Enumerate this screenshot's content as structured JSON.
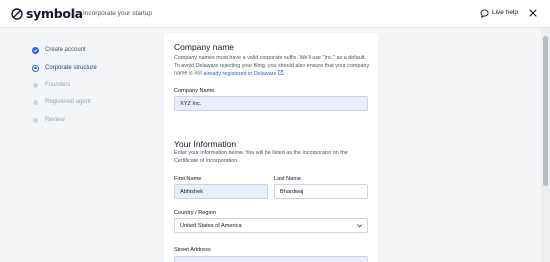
{
  "header": {
    "brand": "symbola",
    "subtitle": "Incorporate your startup",
    "live_help_label": "Live help",
    "icons": [
      "symbola-logo-icon",
      "chat-bubble-icon",
      "close-icon"
    ]
  },
  "steps": [
    {
      "label": "Create account",
      "state": "done"
    },
    {
      "label": "Corporate structure",
      "state": "current"
    },
    {
      "label": "Founders",
      "state": "todo"
    },
    {
      "label": "Registered agent",
      "state": "todo"
    },
    {
      "label": "Review",
      "state": "todo"
    }
  ],
  "company": {
    "title": "Company name",
    "desc_text": "Company names must have a valid corporate suffix. We'll use \"Inc.\" as a default. To avoid Delaware rejecting your filing, you should also ensure that your company name is not",
    "desc_link": "already registered in Delaware",
    "field_label": "Company Name",
    "field_value": "XYZ Inc."
  },
  "info": {
    "title": "Your Information",
    "desc": "Enter your information below. You will be listed as the incorporator on the Certificate of Incorporation.",
    "first_name_label": "First Name",
    "first_name_value": "Abhishek",
    "last_name_label": "Last Name",
    "last_name_value": "Bhardwaj",
    "country_label": "Country / Region",
    "country_value": "United States of America",
    "street_label": "Street Address"
  },
  "colors": {
    "accent": "#2563eb",
    "input_filled_bg": "#e8effc",
    "page_bg": "#f4f5f7"
  }
}
